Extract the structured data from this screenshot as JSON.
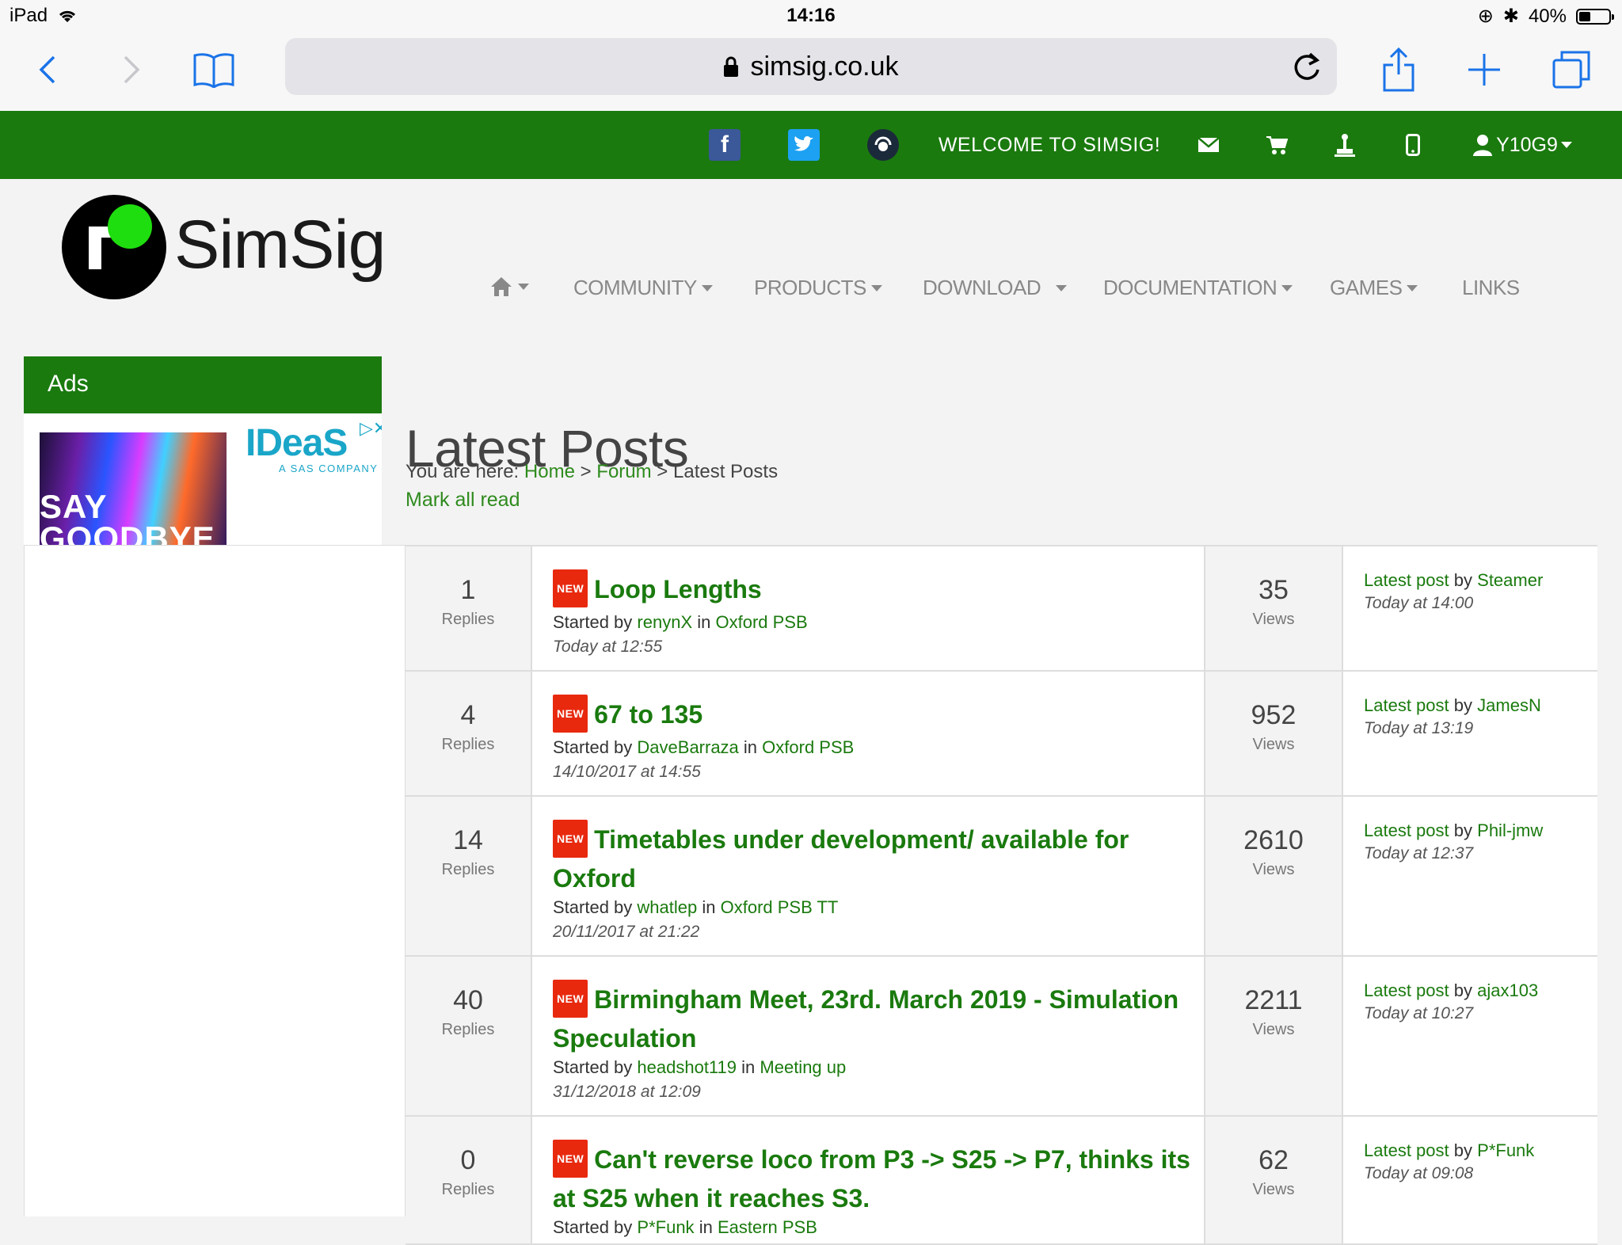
{
  "status_bar": {
    "device": "iPad",
    "time": "14:16",
    "battery": "40%",
    "battery_level": 0.4
  },
  "browser": {
    "url": "simsig.co.uk"
  },
  "topbar": {
    "welcome": "WELCOME TO SIMSIG!",
    "username": "Y10G9"
  },
  "site": {
    "logo_text": "SimSig"
  },
  "nav": {
    "community": "COMMUNITY",
    "products": "PRODUCTS",
    "download": "DOWNLOAD",
    "documentation": "DOCUMENTATION",
    "games": "GAMES",
    "links": "LINKS"
  },
  "sidebar": {
    "ads_title": "Ads",
    "ad": {
      "brand": "IDeaS",
      "tagline": "A SAS COMPANY",
      "image_text": "SAY GOODBYE"
    }
  },
  "page": {
    "title": "Latest Posts",
    "breadcrumb": {
      "prefix": "You are here: ",
      "home": "Home",
      "sep": " > ",
      "forum": "Forum",
      "current": "Latest Posts"
    },
    "mark_all_read": "Mark all read"
  },
  "labels": {
    "new": "NEW",
    "replies": "Replies",
    "views": "Views",
    "started_by": "Started by",
    "in": "in",
    "latest_post": "Latest post",
    "by": "by"
  },
  "posts": [
    {
      "replies": "1",
      "title": "Loop Lengths",
      "author": "renynX",
      "forum": "Oxford PSB",
      "started": "Today at 12:55",
      "views": "35",
      "last_by": "Steamer",
      "last_time": "Today at 14:00"
    },
    {
      "replies": "4",
      "title": "67 to 135",
      "author": "DaveBarraza",
      "forum": "Oxford PSB",
      "started": "14/10/2017 at 14:55",
      "views": "952",
      "last_by": "JamesN",
      "last_time": "Today at 13:19"
    },
    {
      "replies": "14",
      "title": "Timetables under development/ available for Oxford",
      "author": "whatlep",
      "forum": "Oxford PSB TT",
      "started": "20/11/2017 at 21:22",
      "views": "2610",
      "last_by": "Phil-jmw",
      "last_time": "Today at 12:37"
    },
    {
      "replies": "40",
      "title": "Birmingham Meet, 23rd. March 2019 - Simulation Speculation",
      "author": "headshot119",
      "forum": "Meeting up",
      "started": "31/12/2018 at 12:09",
      "views": "2211",
      "last_by": "ajax103",
      "last_time": "Today at 10:27"
    },
    {
      "replies": "0",
      "title": "Can't reverse loco from P3 -> S25 -> P7, thinks its at S25 when it reaches S3.",
      "author": "P*Funk",
      "forum": "Eastern PSB",
      "started": "",
      "views": "62",
      "last_by": "P*Funk",
      "last_time": "Today at 09:08"
    }
  ]
}
